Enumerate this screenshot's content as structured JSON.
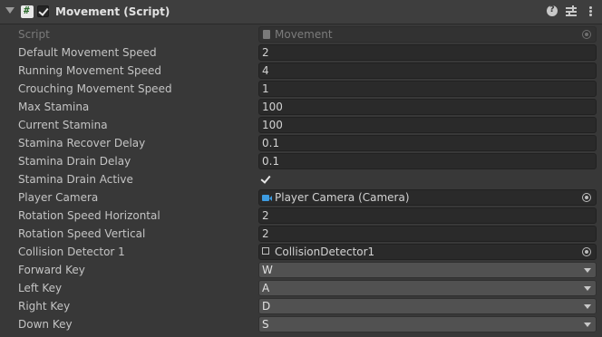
{
  "component": {
    "title": "Movement (Script)",
    "enabled": true
  },
  "fields": {
    "script": {
      "label": "Script",
      "value": "Movement"
    },
    "default_movement_speed": {
      "label": "Default Movement Speed",
      "value": "2"
    },
    "running_movement_speed": {
      "label": "Running Movement Speed",
      "value": "4"
    },
    "crouching_movement_speed": {
      "label": "Crouching Movement Speed",
      "value": "1"
    },
    "max_stamina": {
      "label": "Max Stamina",
      "value": "100"
    },
    "current_stamina": {
      "label": "Current Stamina",
      "value": "100"
    },
    "stamina_recover_delay": {
      "label": "Stamina Recover Delay",
      "value": "0.1"
    },
    "stamina_drain_delay": {
      "label": "Stamina Drain Delay",
      "value": "0.1"
    },
    "stamina_drain_active": {
      "label": "Stamina Drain Active",
      "checked": true
    },
    "player_camera": {
      "label": "Player Camera",
      "value": "Player Camera (Camera)"
    },
    "rotation_speed_horizontal": {
      "label": "Rotation Speed Horizontal",
      "value": "2"
    },
    "rotation_speed_vertical": {
      "label": "Rotation Speed Vertical",
      "value": "2"
    },
    "collision_detector_1": {
      "label": "Collision Detector 1",
      "value": "CollisionDetector1"
    },
    "forward_key": {
      "label": "Forward Key",
      "value": "W"
    },
    "left_key": {
      "label": "Left Key",
      "value": "A"
    },
    "right_key": {
      "label": "Right Key",
      "value": "D"
    },
    "down_key": {
      "label": "Down Key",
      "value": "S"
    }
  },
  "icons": {
    "foldout": "triangle-down-icon",
    "script": "csharp-script-icon",
    "help": "help-icon",
    "presets": "presets-icon",
    "more": "kebab-menu-icon",
    "camera": "camera-icon",
    "gameobject": "cube-icon",
    "object_picker": "object-picker-icon"
  },
  "colors": {
    "panel_bg": "#383838",
    "header_bg": "#3e3e3e",
    "field_bg": "#2a2a2a",
    "dropdown_bg": "#515151",
    "text": "#c4c4c4",
    "camera_icon": "#3d9be0"
  }
}
